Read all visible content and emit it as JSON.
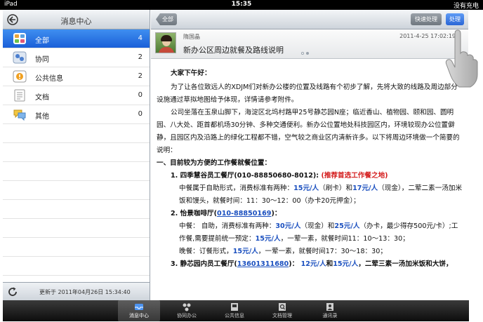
{
  "status_bar": {
    "device": "iPad",
    "time": "15:35",
    "battery": "没有充电"
  },
  "left_panel": {
    "title": "消息中心",
    "items": [
      {
        "label": "全部",
        "count": "4",
        "icon": "grid-icon",
        "active": true
      },
      {
        "label": "协同",
        "count": "2",
        "icon": "collaboration-icon",
        "active": false
      },
      {
        "label": "公共信息",
        "count": "2",
        "icon": "info-icon",
        "active": false
      },
      {
        "label": "文档",
        "count": "0",
        "icon": "document-icon",
        "active": false
      },
      {
        "label": "其他",
        "count": "0",
        "icon": "chat-icon",
        "active": false
      }
    ],
    "footer": {
      "updated_text": "更新于 2011年04月26日 15:34:40"
    }
  },
  "right_panel": {
    "back_label": "全部",
    "quick_label": "快速处理",
    "handle_label": "处理",
    "message": {
      "sender": "隋国晶",
      "time": "2011-4-25 17:02:19",
      "title": "新办公区周边就餐及路线说明"
    },
    "body": {
      "greeting": "大家下午好：",
      "para1": "为了让各位致远人的XDJM们对新办公楼的位置及线路有个初步了解，先将大致的线路及周边部分设施通过草拟地图给予体现，详情请参考附件。",
      "para2": "公司坐落在玉泉山脚下，海淀区北坞村路甲25号静芯园N座；临近香山、植物园、颐和园、圆明园、八大处、距首都机场30分钟、多种交通便利。新办公位置地处科技园区内，环境较现办公位置僻静，且园区内及沿路上的绿化工程都不错，空气较之商业区内清新许多。以下将周边环境做一个简要的说明：",
      "section1": "一、目前较为方便的工作餐就餐位置：",
      "item1_title": "1.  四季慧谷员工餐厅(010-88850680-8012):",
      "item1_note": "(推荐首选工作餐之地)",
      "item1_a": "中餐属于自助形式，消费标准有两种：",
      "item1_p1": "15元/人",
      "item1_b": "（刷卡）和",
      "item1_p2": "17元/人",
      "item1_c": "（现金），二荤二素一汤加米饭和馒头，就餐时间：11：30～12：00（办卡20元押金）；",
      "item2_title": "2.  怡景咖啡厅(",
      "item2_phone": "010-88850169",
      "item2_end": ")：",
      "item2_a": "中餐：  自助，消费标准有两种：",
      "item2_p1": "30元/人",
      "item2_b": "（现金）和",
      "item2_p2": "25元/人",
      "item2_c": "（办卡，最少得存500元/卡）;工作餐,需要提前统一预定：",
      "item2_p3": "15元/人",
      "item2_d": "，一荤一素，就餐时间11：10～13：30；",
      "item2_e": "晚餐：订餐形式，",
      "item2_p4": "15元/人",
      "item2_f": "，一荤一素，就餐时间17：30～18：30；",
      "item3_title": "3.  静芯园内员工餐厅(",
      "item3_phone": "13601311680",
      "item3_end": ")：",
      "item3_p1": "12元/人",
      "item3_a": "和",
      "item3_p2": "15元/人",
      "item3_b": "，二荤三素一汤加米饭和大饼，"
    }
  },
  "tab_bar": {
    "tabs": [
      {
        "label": "消息中心",
        "active": true
      },
      {
        "label": "协同办公",
        "active": false
      },
      {
        "label": "公共信息",
        "active": false
      },
      {
        "label": "文档管理",
        "active": false
      },
      {
        "label": "通讯录",
        "active": false
      }
    ]
  },
  "colors": {
    "accent": "#2a66d6",
    "price_blue": "#1a4fbf",
    "note_red": "#d41c1c"
  }
}
